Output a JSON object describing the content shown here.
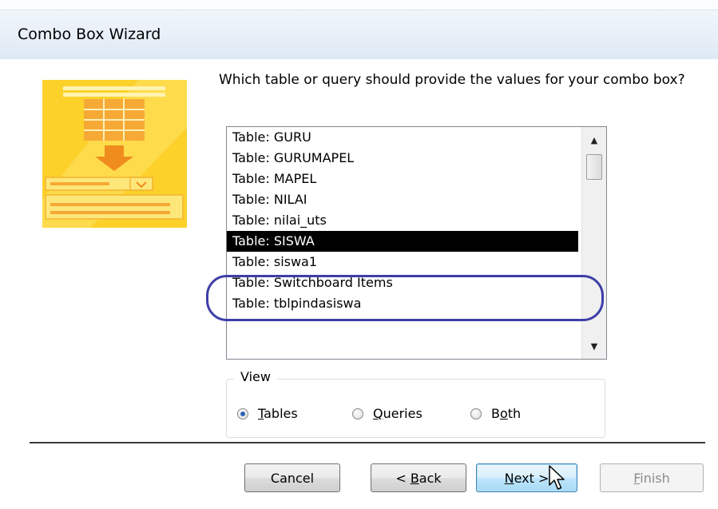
{
  "window": {
    "title": "Combo Box Wizard"
  },
  "prompt": "Which table or query should provide the values for your combo box?",
  "list": {
    "items": [
      "Table: GURU",
      "Table: GURUMAPEL",
      "Table: MAPEL",
      "Table: NILAI",
      "Table: nilai_uts",
      "Table: SISWA",
      "Table: siswa1",
      "Table: Switchboard Items",
      "Table: tblpindasiswa"
    ],
    "selected_index": 5,
    "scroll_up_icon": "scroll-up-arrow",
    "scroll_down_icon": "scroll-down-arrow"
  },
  "view": {
    "legend": "View",
    "options": [
      {
        "prefix": "",
        "accel": "T",
        "rest": "ables",
        "checked": true
      },
      {
        "prefix": "",
        "accel": "Q",
        "rest": "ueries",
        "checked": false
      },
      {
        "prefix": "B",
        "accel": "o",
        "rest": "th",
        "checked": false
      }
    ]
  },
  "buttons": {
    "cancel": "Cancel",
    "back_prefix": "< ",
    "back_accel": "B",
    "back_rest": "ack",
    "next_accel": "N",
    "next_rest": "ext >",
    "finish_accel": "F",
    "finish_rest": "inish"
  },
  "colors": {
    "selection_bg": "#000000",
    "annotation_ellipse": "#3e3ea8",
    "wizard_art_yellow": "#fcd12a"
  },
  "icons": [
    "wizard-combo-box-illustration",
    "mouse-pointer-icon"
  ]
}
